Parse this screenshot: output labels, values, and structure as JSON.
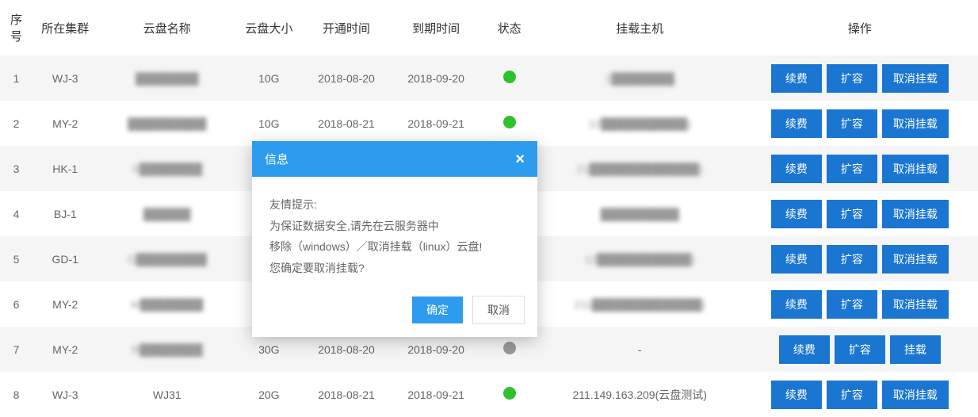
{
  "headers": {
    "idx": "序号",
    "cluster": "所在集群",
    "name": "云盘名称",
    "size": "云盘大小",
    "open_time": "开通时间",
    "expire_time": "到期时间",
    "status": "状态",
    "host": "挂载主机",
    "ops": "操作"
  },
  "buttons": {
    "renew": "续费",
    "expand": "扩容",
    "unmount": "取消挂载",
    "mount": "挂载"
  },
  "rows": [
    {
      "idx": "1",
      "cluster": "WJ-3",
      "name": "████████",
      "size": "10G",
      "open": "2018-08-20",
      "expire": "2018-09-20",
      "status": "green",
      "host": "1████████",
      "name_blur": true,
      "host_blur": true,
      "mounted": true
    },
    {
      "idx": "2",
      "cluster": "MY-2",
      "name": "██████████",
      "size": "10G",
      "open": "2018-08-21",
      "expire": "2018-09-21",
      "status": "green",
      "host": "12███████████)",
      "name_blur": true,
      "host_blur": true,
      "mounted": true
    },
    {
      "idx": "3",
      "cluster": "HK-1",
      "name": "X████████",
      "size": "",
      "open": "",
      "expire": "",
      "status": "",
      "host": "21██████████████)",
      "name_blur": true,
      "host_blur": true,
      "mounted": true
    },
    {
      "idx": "4",
      "cluster": "BJ-1",
      "name": "██████",
      "size": "",
      "open": "",
      "expire": "",
      "status": "",
      "host": "██████████",
      "name_blur": true,
      "host_blur": true,
      "mounted": true
    },
    {
      "idx": "5",
      "cluster": "GD-1",
      "name": "G█████████",
      "size": "",
      "open": "",
      "expire": "",
      "status": "",
      "host": "12████████████)",
      "name_blur": true,
      "host_blur": true,
      "mounted": true
    },
    {
      "idx": "6",
      "cluster": "MY-2",
      "name": "M████████",
      "size": "",
      "open": "",
      "expire": "",
      "status": "",
      "host": "211██████████████)",
      "name_blur": true,
      "host_blur": true,
      "mounted": true
    },
    {
      "idx": "7",
      "cluster": "MY-2",
      "name": "R████████",
      "size": "30G",
      "open": "2018-08-20",
      "expire": "2018-09-20",
      "status": "grey",
      "host": "-",
      "name_blur": true,
      "host_blur": false,
      "mounted": false
    },
    {
      "idx": "8",
      "cluster": "WJ-3",
      "name": "WJ31",
      "size": "20G",
      "open": "2018-08-21",
      "expire": "2018-09-21",
      "status": "green",
      "host": "211.149.163.209(云盘测试)",
      "name_blur": false,
      "host_blur": false,
      "mounted": true
    }
  ],
  "modal": {
    "title": "信息",
    "line1": "友情提示:",
    "line2": "为保证数据安全,请先在云服务器中",
    "line3": "移除（windows）／取消挂载（linux）云盘!",
    "line4": "您确定要取消挂载?",
    "ok": "确定",
    "cancel": "取消"
  }
}
